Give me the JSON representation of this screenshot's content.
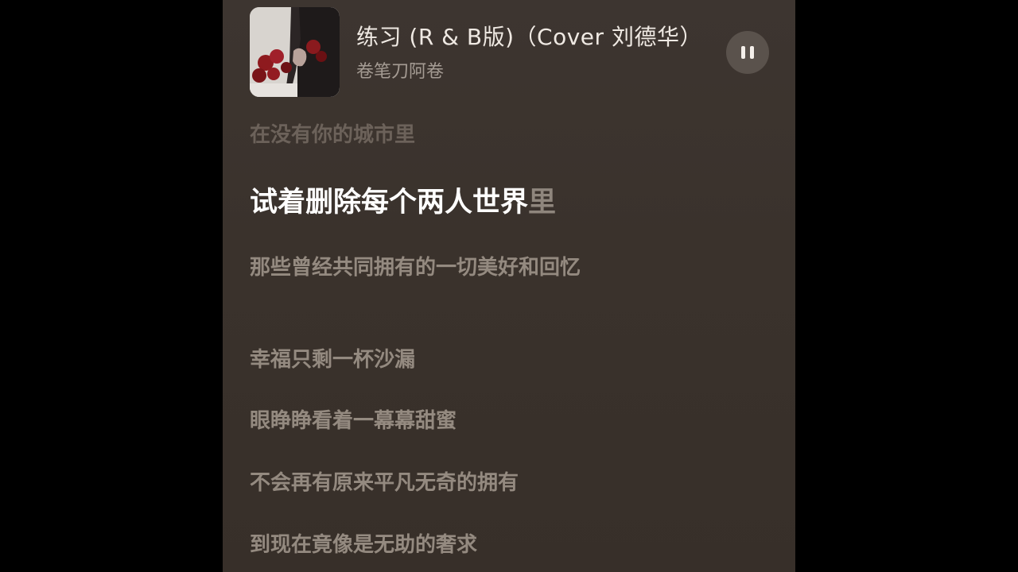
{
  "now_playing": {
    "title": "练习 (R & B版)（Cover 刘德华）",
    "artist": "卷笔刀阿卷",
    "state": "playing",
    "control_icon": "pause-icon"
  },
  "lyrics": {
    "previous": "在没有你的城市里",
    "current_sung": "试着删除每个两人世界",
    "current_unsung": "里",
    "upcoming": [
      "那些曾经共同拥有的一切美好和回忆",
      "幸福只剩一杯沙漏",
      "眼睁睁看着一幕幕甜蜜",
      "不会再有原来平凡无奇的拥有",
      "到现在竟像是无助的奢求"
    ]
  },
  "colors": {
    "background": "#3a322c",
    "active_lyric": "#ffffff",
    "inactive_lyric": "#948a80"
  }
}
